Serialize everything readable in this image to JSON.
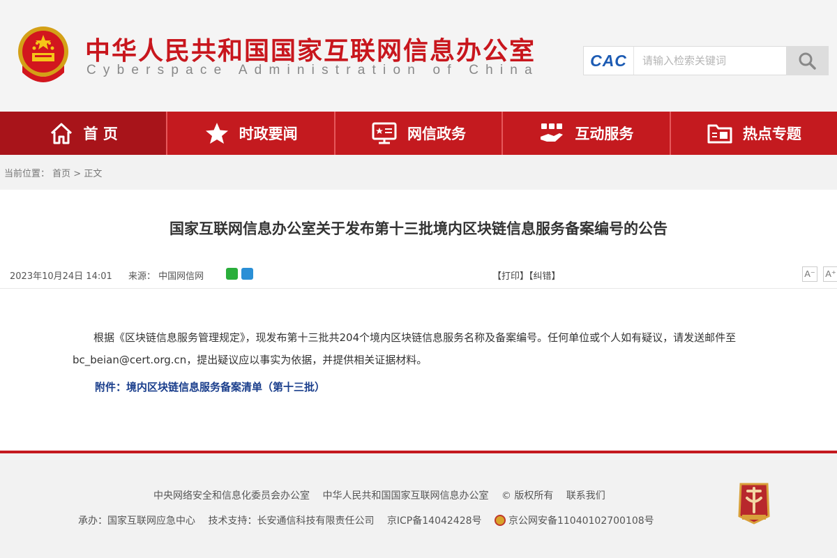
{
  "header": {
    "title": "中华人民共和国国家互联网信息办公室",
    "subtitle": "Cyberspace Administration of China",
    "logo_text": "CAC",
    "search_placeholder": "请输入检索关键词"
  },
  "nav": {
    "items": [
      {
        "label": "首 页",
        "icon": "home-icon"
      },
      {
        "label": "时政要闻",
        "icon": "star-icon"
      },
      {
        "label": "网信政务",
        "icon": "monitor-icon"
      },
      {
        "label": "互动服务",
        "icon": "handshake-icon"
      },
      {
        "label": "热点专题",
        "icon": "folder-icon"
      }
    ]
  },
  "breadcrumb": {
    "prefix": "当前位置：",
    "home": "首页",
    "separator": " > ",
    "current": "正文"
  },
  "article": {
    "title": "国家互联网信息办公室关于发布第十三批境内区块链信息服务备案编号的公告",
    "date": "2023年10月24日  14:01",
    "source_label": "来源：",
    "source": "中国网信网",
    "print": "【打印】",
    "correct": "【纠错】",
    "font_decrease": "A⁻",
    "font_increase": "A⁺",
    "body": "根据《区块链信息服务管理规定》，现发布第十三批共204个境内区块链信息服务名称及备案编号。任何单位或个人如有疑议，请发送邮件至bc_beian@cert.org.cn，提出疑议应以事实为依据，并提供相关证据材料。",
    "attachment": "附件：境内区块链信息服务备案清单（第十三批）"
  },
  "footer": {
    "org1": "中央网络安全和信息化委员会办公室",
    "org2": "中华人民共和国国家互联网信息办公室",
    "copyright": "© 版权所有",
    "contact": "联系我们",
    "host": "承办：国家互联网应急中心",
    "tech": "技术支持：长安通信科技有限责任公司",
    "icp": "京ICP备14042428号",
    "police": "京公网安备11040102700108号"
  },
  "colors": {
    "brand_red": "#c41a1f",
    "link_blue": "#1a3e8c"
  }
}
